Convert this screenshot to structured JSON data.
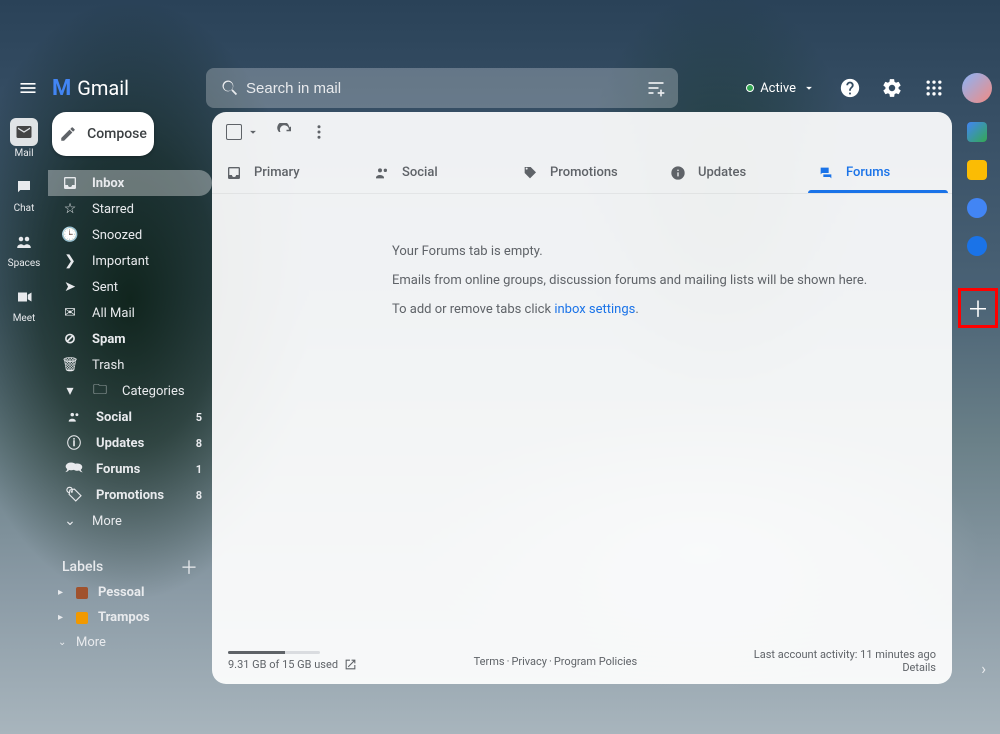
{
  "header": {
    "product": "Gmail",
    "search_placeholder": "Search in mail",
    "status_label": "Active"
  },
  "rail": [
    {
      "id": "mail",
      "label": "Mail"
    },
    {
      "id": "chat",
      "label": "Chat"
    },
    {
      "id": "spaces",
      "label": "Spaces"
    },
    {
      "id": "meet",
      "label": "Meet"
    }
  ],
  "compose_label": "Compose",
  "nav": {
    "main": [
      {
        "id": "inbox",
        "label": "Inbox",
        "active": true
      },
      {
        "id": "starred",
        "label": "Starred"
      },
      {
        "id": "snoozed",
        "label": "Snoozed"
      },
      {
        "id": "important",
        "label": "Important"
      },
      {
        "id": "sent",
        "label": "Sent"
      },
      {
        "id": "all",
        "label": "All Mail"
      },
      {
        "id": "spam",
        "label": "Spam"
      },
      {
        "id": "trash",
        "label": "Trash"
      },
      {
        "id": "categories",
        "label": "Categories"
      }
    ],
    "sub": [
      {
        "id": "social",
        "label": "Social",
        "count": "5"
      },
      {
        "id": "updates",
        "label": "Updates",
        "count": "8"
      },
      {
        "id": "forums",
        "label": "Forums",
        "count": "1"
      },
      {
        "id": "promotions",
        "label": "Promotions",
        "count": "8"
      }
    ],
    "more": "More"
  },
  "labels": {
    "header": "Labels",
    "items": [
      {
        "id": "pessoal",
        "label": "Pessoal",
        "color": "#a0522d"
      },
      {
        "id": "trampos",
        "label": "Trampos",
        "color": "#f29900"
      }
    ],
    "more": "More"
  },
  "tabs": [
    {
      "id": "primary",
      "label": "Primary"
    },
    {
      "id": "social",
      "label": "Social"
    },
    {
      "id": "promotions",
      "label": "Promotions"
    },
    {
      "id": "updates",
      "label": "Updates"
    },
    {
      "id": "forums",
      "label": "Forums",
      "active": true
    }
  ],
  "empty_state": {
    "line1": "Your Forums tab is empty.",
    "line2": "Emails from online groups, discussion forums and mailing lists will be shown here.",
    "line3_prefix": "To add or remove tabs click ",
    "link": "inbox settings",
    "line3_suffix": "."
  },
  "footer": {
    "storage": "9.31 GB of 15 GB used",
    "terms": "Terms",
    "privacy": "Privacy",
    "policies": "Program Policies",
    "activity": "Last account activity: 11 minutes ago",
    "details": "Details"
  }
}
